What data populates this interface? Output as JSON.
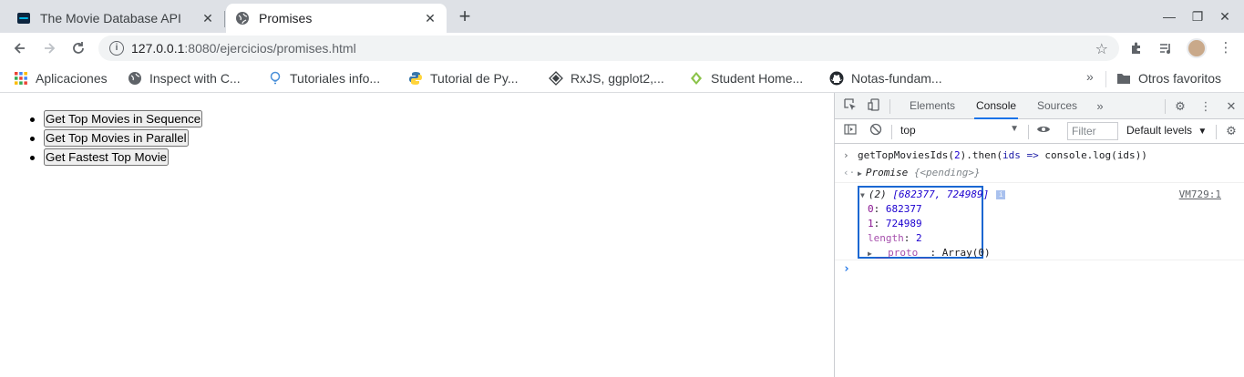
{
  "browser": {
    "tabs": [
      {
        "title": "The Movie Database API",
        "active": false,
        "favicon": "tmdb-icon"
      },
      {
        "title": "Promises",
        "active": true,
        "favicon": "globe-icon"
      }
    ],
    "url": {
      "host": "127.0.0.1",
      "path": ":8080/ejercicios/promises.html"
    },
    "bookmarks": [
      {
        "label": "Aplicaciones",
        "icon": "apps-grid-icon"
      },
      {
        "label": "Inspect with C...",
        "icon": "globe-icon"
      },
      {
        "label": "Tutoriales info...",
        "icon": "bulb-icon"
      },
      {
        "label": "Tutorial de Py...",
        "icon": "python-icon"
      },
      {
        "label": "RxJS, ggplot2,...",
        "icon": "diamond-icon"
      },
      {
        "label": "Student Home...",
        "icon": "leaf-icon"
      },
      {
        "label": "Notas-fundam...",
        "icon": "github-icon"
      }
    ],
    "bookmarks_more": "»",
    "other_bookmarks": "Otros favoritos"
  },
  "page": {
    "buttons": [
      "Get Top Movies in Sequence",
      "Get Top Movies in Parallel",
      "Get Fastest Top Movie"
    ]
  },
  "devtools": {
    "tabs": [
      "Elements",
      "Console",
      "Sources"
    ],
    "active_tab": "Console",
    "context": "top",
    "filter_placeholder": "Filter",
    "levels": "Default levels",
    "console": {
      "input_line": {
        "fn": "getTopMoviesIds",
        "arg": "2",
        "rest_a": ").then(",
        "param": "ids",
        "arrow": " => ",
        "call": "console.log(",
        "param2": "ids",
        "close": "))"
      },
      "result": {
        "name": "Promise",
        "state": "{<pending>}"
      },
      "log": {
        "summary_prefix": "(2) ",
        "summary": "[682377, 724989]",
        "source": "VM729:1",
        "entries": [
          {
            "key": "0",
            "value": "682377"
          },
          {
            "key": "1",
            "value": "724989"
          },
          {
            "key": "length",
            "value": "2"
          }
        ],
        "proto_key": "__proto__",
        "proto_value": "Array(0)"
      }
    }
  }
}
